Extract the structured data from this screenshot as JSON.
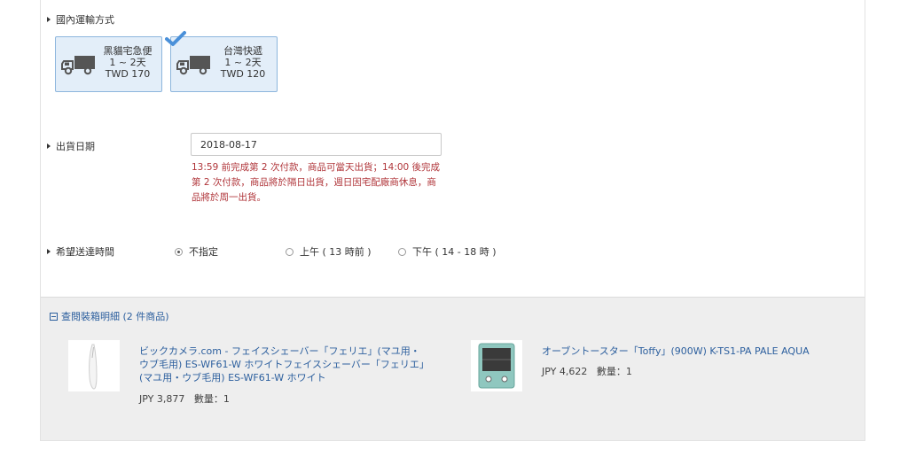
{
  "shipping": {
    "label": "國內運輸方式",
    "options": [
      {
        "name": "黑貓宅急便",
        "days": "1 ~ 2天",
        "price": "TWD 170",
        "selected": false
      },
      {
        "name": "台灣快遞",
        "days": "1 ~ 2天",
        "price": "TWD 120",
        "selected": true
      }
    ]
  },
  "ship_date": {
    "label": "出貨日期",
    "value": "2018-08-17",
    "note": "13:59 前完成第 2 次付款，商品可當天出貨；14:00 後完成第 2 次付款，商品將於隔日出貨，週日因宅配廠商休息，商品將於周一出貨。"
  },
  "delivery_time": {
    "label": "希望送達時間",
    "options": [
      {
        "label": "不指定",
        "selected": true
      },
      {
        "label": "上午 ( 13 時前 )",
        "selected": false
      },
      {
        "label": "下午 ( 14 - 18 時 )",
        "selected": false
      }
    ]
  },
  "detail": {
    "toggle_label": "查閱裝箱明細 (2 件商品)",
    "products": [
      {
        "title": "ビックカメラ.com - フェイスシェーバー「フェリエ」(マユ用・ウブ毛用) ES-WF61-W ホワイトフェイスシェーバー「フェリエ」(マユ用・ウブ毛用) ES-WF61-W ホワイト",
        "price": "JPY 3,877",
        "qty": "數量：1"
      },
      {
        "title": "オーブントースター「Toffy」(900W) K-TS1-PA PALE AQUA",
        "price": "JPY 4,622",
        "qty": "數量：1"
      }
    ]
  },
  "colors": {
    "accent": "#2c5f9e",
    "warning": "#b0353a",
    "selected_card_bg": "#e3eef9",
    "check": "#4a90d9"
  }
}
